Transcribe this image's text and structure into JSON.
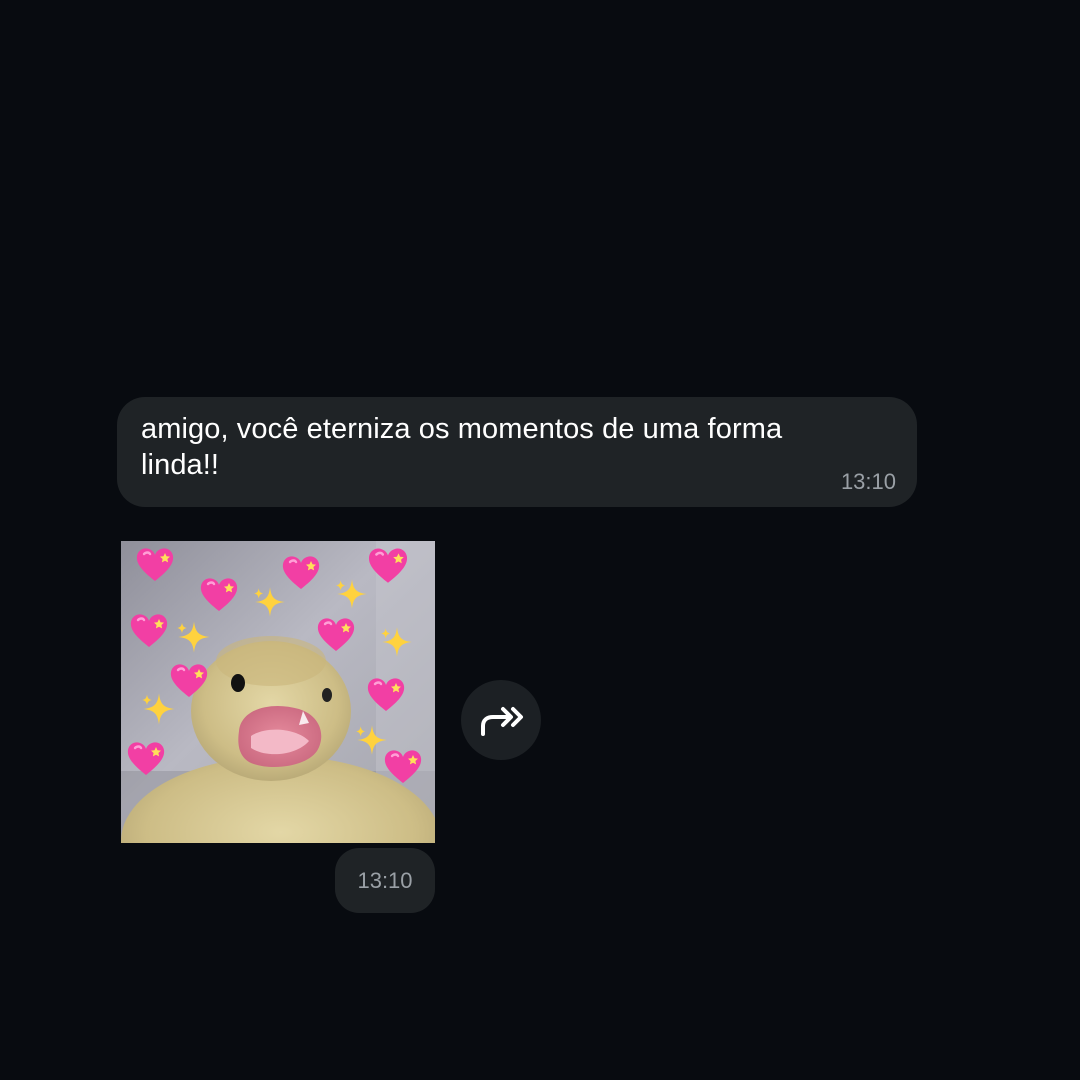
{
  "messages": [
    {
      "type": "text",
      "text": "amigo, você eterniza os momentos de uma forma linda!!",
      "time": "13:10"
    },
    {
      "type": "sticker",
      "sticker_subject": "duckling with pink hearts and sparkles",
      "time": "13:10"
    }
  ],
  "icons": {
    "forward": "forward-icon"
  },
  "colors": {
    "background": "#080b10",
    "bubble": "#1f2326",
    "text": "#ffffff",
    "timestamp": "#9aa0a6",
    "forward_button": "#1c2024"
  }
}
